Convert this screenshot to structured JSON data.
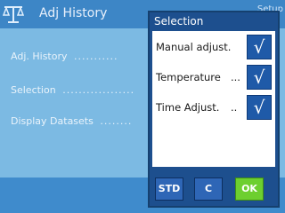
{
  "header": {
    "title": "Adj History",
    "corner_text": "Setup"
  },
  "background_rows": [
    {
      "label": "Adj. History",
      "dots": "..........."
    },
    {
      "label": "Selection",
      "dots": ".................."
    },
    {
      "label": "Display Datasets",
      "dots": "........"
    }
  ],
  "dialog": {
    "title": "Selection",
    "options": [
      {
        "label": "Manual adjust.",
        "dots": "",
        "checked": true
      },
      {
        "label": "Temperature",
        "dots": "...",
        "checked": true
      },
      {
        "label": "Time Adjust.",
        "dots": "..",
        "checked": true
      }
    ],
    "check_glyph": "√",
    "buttons": {
      "std": "STD",
      "c": "C",
      "ok": "OK"
    }
  },
  "colors": {
    "titlebar": "#3d86c6",
    "content": "#7cbae3",
    "dialog": "#1d4f8e",
    "checkbox": "#1f5aa8",
    "ok_button": "#6dcf2f"
  },
  "icons": {
    "app": "balance-scale-icon",
    "check": "checkmark-icon"
  }
}
